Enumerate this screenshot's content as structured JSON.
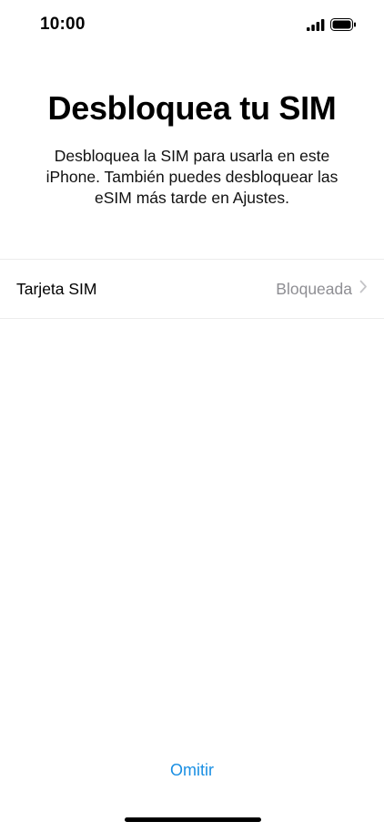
{
  "status_bar": {
    "time": "10:00",
    "signal_icon": "cellular-signal-icon",
    "battery_icon": "battery-full-icon"
  },
  "title": "Desbloquea tu SIM",
  "subtitle": "Desbloquea la SIM para usarla en este iPhone. También puedes desbloquear las eSIM más tarde en Ajustes.",
  "sim_list": {
    "items": [
      {
        "label": "Tarjeta SIM",
        "value": "Bloqueada",
        "icon": "chevron-right-icon"
      }
    ]
  },
  "skip_label": "Omitir",
  "colors": {
    "accent": "#1a8fe3",
    "secondary_text": "#8e8e93",
    "separator": "#ececec"
  }
}
